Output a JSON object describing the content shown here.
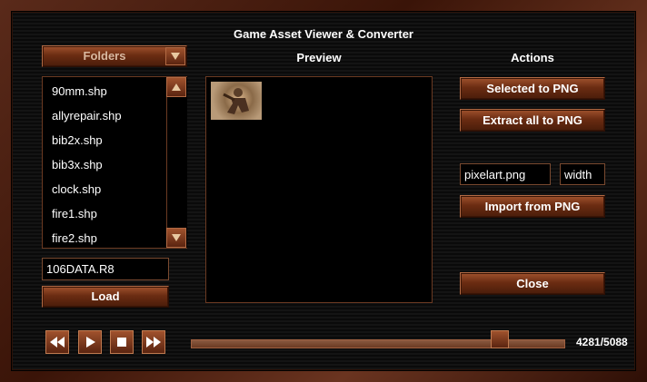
{
  "window": {
    "title": "Game Asset Viewer & Converter"
  },
  "folders": {
    "label": "Folders"
  },
  "files": [
    "90mm.shp",
    "allyrepair.shp",
    "bib2x.shp",
    "bib3x.shp",
    "clock.shp",
    "fire1.shp",
    "fire2.shp"
  ],
  "mix_field": {
    "value": "106DATA.R8"
  },
  "load_label": "Load",
  "preview": {
    "label": "Preview"
  },
  "actions": {
    "label": "Actions",
    "selected_png": "Selected to PNG",
    "extract_all": "Extract all to PNG",
    "png_name": "pixelart.png",
    "width": "width",
    "import_png": "Import from PNG",
    "close": "Close"
  },
  "playback": {
    "frame_counter": "4281/5088",
    "progress": 0.843
  },
  "colors": {
    "accent": "#8b3a1a",
    "frame": "#5a2a1a"
  }
}
